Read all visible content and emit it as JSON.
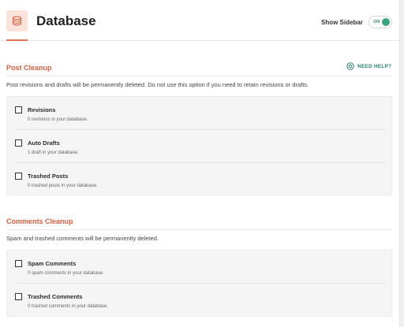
{
  "header": {
    "title": "Database",
    "sidebar_label": "Show Sidebar",
    "toggle_state": "ON"
  },
  "post_cleanup": {
    "title": "Post Cleanup",
    "help_label": "NEED HELP?",
    "description": "Post revisions and drafts will be permanently deleted. Do not use this option if you need to retain revisions or drafts.",
    "options": [
      {
        "label": "Revisions",
        "description": "0 revisions in your database."
      },
      {
        "label": "Auto Drafts",
        "description": "1 draft in your database."
      },
      {
        "label": "Trashed Posts",
        "description": "0 trashed posts in your database."
      }
    ]
  },
  "comments_cleanup": {
    "title": "Comments Cleanup",
    "description": "Spam and trashed comments will be permanently deleted.",
    "options": [
      {
        "label": "Spam Comments",
        "description": "0 spam comments in your database."
      },
      {
        "label": "Trashed Comments",
        "description": "0 trashed comments in your database."
      }
    ]
  },
  "colors": {
    "accent": "#d3603f",
    "toggle_on": "#3aa57f",
    "help_text": "#2c7f6c"
  }
}
